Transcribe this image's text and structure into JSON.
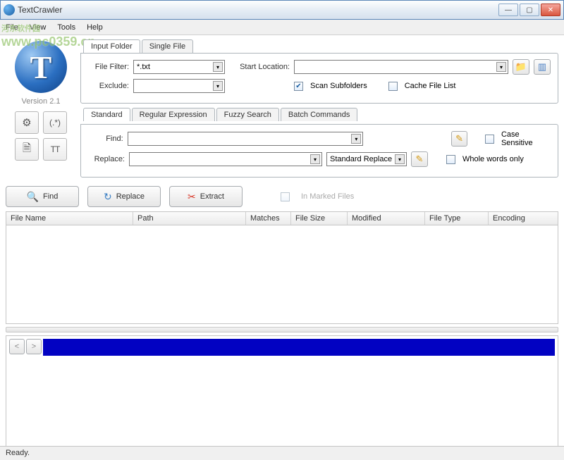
{
  "window": {
    "title": "TextCrawler"
  },
  "menubar": [
    "File",
    "View",
    "Tools",
    "Help"
  ],
  "left": {
    "logo_letter": "T",
    "version": "Version 2.1",
    "icons": [
      "⚙",
      "(.*)",
      "🗎",
      "TT"
    ]
  },
  "input": {
    "tabs": [
      "Input Folder",
      "Single File"
    ],
    "file_filter_label": "File Filter:",
    "file_filter_value": "*.txt",
    "start_location_label": "Start Location:",
    "exclude_label": "Exclude:",
    "scan_subfolders_label": "Scan Subfolders",
    "cache_file_list_label": "Cache File List"
  },
  "search": {
    "tabs": [
      "Standard",
      "Regular Expression",
      "Fuzzy Search",
      "Batch Commands"
    ],
    "find_label": "Find:",
    "replace_label": "Replace:",
    "replace_mode": "Standard Replace",
    "case_sensitive_label": "Case Sensitive",
    "whole_words_label": "Whole words only"
  },
  "actions": {
    "find": "Find",
    "replace": "Replace",
    "extract": "Extract",
    "in_marked": "In Marked Files"
  },
  "table": {
    "cols": [
      "File Name",
      "Path",
      "Matches",
      "File Size",
      "Modified",
      "File Type",
      "Encoding"
    ]
  },
  "nav": {
    "prev": "<",
    "next": ">"
  },
  "status": "Ready.",
  "watermark": {
    "line1": "河东软件园",
    "line2": "www.pc0359.cn"
  }
}
